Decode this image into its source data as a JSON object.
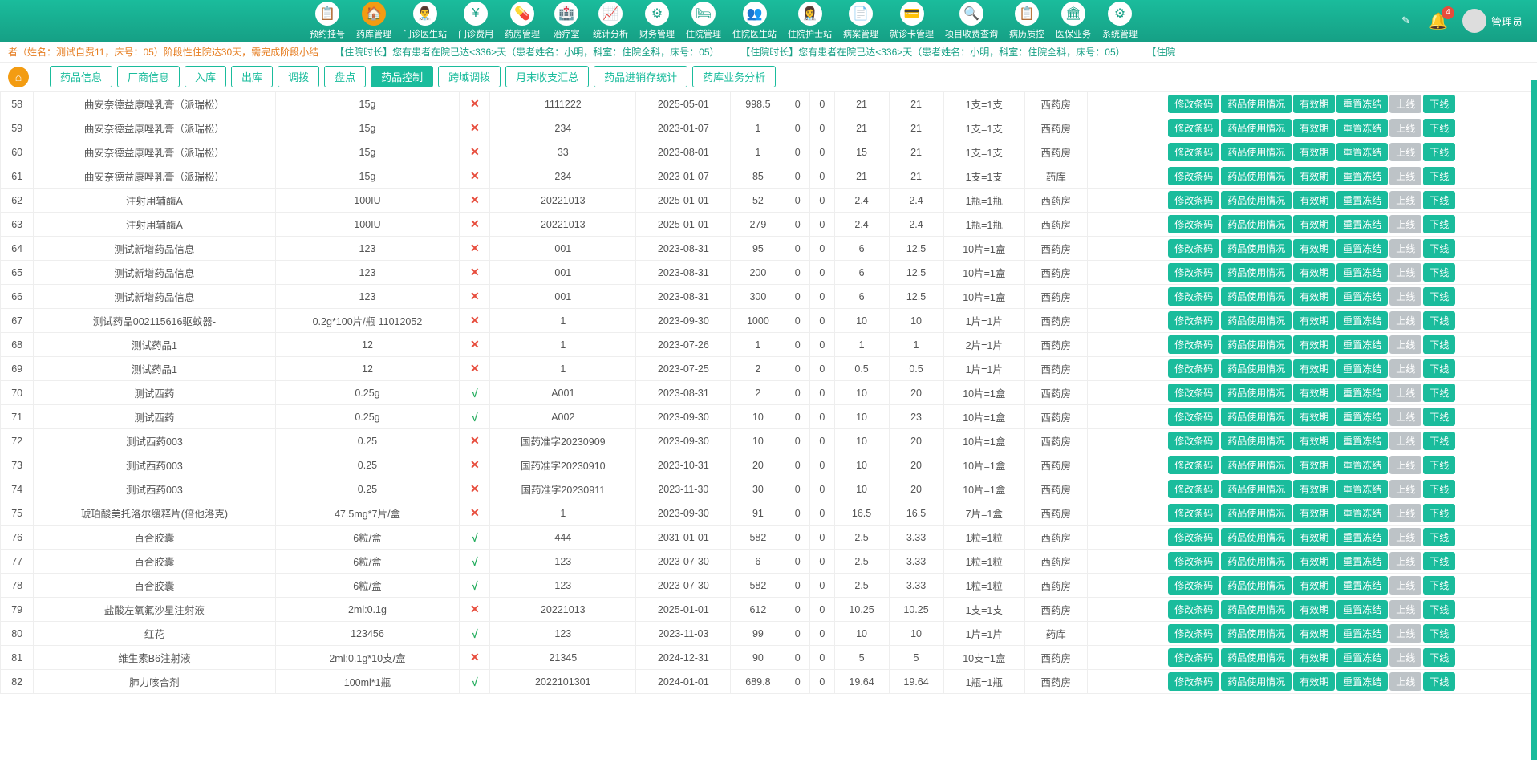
{
  "topnav": [
    {
      "label": "预约挂号",
      "icon": "📋"
    },
    {
      "label": "药库管理",
      "icon": "🏠",
      "active": true
    },
    {
      "label": "门诊医生站",
      "icon": "👨‍⚕️"
    },
    {
      "label": "门诊费用",
      "icon": "¥"
    },
    {
      "label": "药房管理",
      "icon": "💊"
    },
    {
      "label": "治疗室",
      "icon": "🏥"
    },
    {
      "label": "统计分析",
      "icon": "📈"
    },
    {
      "label": "财务管理",
      "icon": "⚙"
    },
    {
      "label": "住院管理",
      "icon": "🛏"
    },
    {
      "label": "住院医生站",
      "icon": "👥"
    },
    {
      "label": "住院护士站",
      "icon": "👩‍⚕️"
    },
    {
      "label": "病案管理",
      "icon": "📄"
    },
    {
      "label": "就诊卡管理",
      "icon": "💳"
    },
    {
      "label": "项目收费查询",
      "icon": "🔍"
    },
    {
      "label": "病历质控",
      "icon": "📋"
    },
    {
      "label": "医保业务",
      "icon": "🏛"
    },
    {
      "label": "系统管理",
      "icon": "⚙"
    }
  ],
  "notif_count": "4",
  "user_name": "管理员",
  "marquee": {
    "s1a": "者（姓名：测试自费11，床号：05）阶段性住院达30天，需完成阶段小结",
    "s1b": "【住院时长】您有患者在院已达<336>天（患者姓名：小明，科室：住院全科，床号：05）",
    "s1c": "【住院时长】您有患者在院已达<336>天（患者姓名：小明，科室：住院全科，床号：05）",
    "s1d": "【住院"
  },
  "tabs": [
    "药品信息",
    "厂商信息",
    "入库",
    "出库",
    "调拨",
    "盘点",
    "药品控制",
    "跨域调拨",
    "月末收支汇总",
    "药品进销存统计",
    "药库业务分析"
  ],
  "active_tab": 6,
  "actions": {
    "a1": "修改条码",
    "a2": "药品使用情况",
    "a3": "有效期",
    "a4": "重置冻结",
    "a5": "上线",
    "a6": "下线"
  },
  "rows": [
    {
      "idx": "58",
      "name": "曲安奈德益康唑乳膏（派瑞松）",
      "spec": "15g",
      "stop": "x",
      "batch": "1111222",
      "exp": "2025-05-01",
      "qty": "998.5",
      "c1": "0",
      "c2": "0",
      "c3": "21",
      "c4": "21",
      "unit": "1支=1支",
      "loc": "西药房"
    },
    {
      "idx": "59",
      "name": "曲安奈德益康唑乳膏（派瑞松）",
      "spec": "15g",
      "stop": "x",
      "batch": "234",
      "exp": "2023-01-07",
      "qty": "1",
      "c1": "0",
      "c2": "0",
      "c3": "21",
      "c4": "21",
      "unit": "1支=1支",
      "loc": "西药房"
    },
    {
      "idx": "60",
      "name": "曲安奈德益康唑乳膏（派瑞松）",
      "spec": "15g",
      "stop": "x",
      "batch": "33",
      "exp": "2023-08-01",
      "qty": "1",
      "c1": "0",
      "c2": "0",
      "c3": "15",
      "c4": "21",
      "unit": "1支=1支",
      "loc": "西药房"
    },
    {
      "idx": "61",
      "name": "曲安奈德益康唑乳膏（派瑞松）",
      "spec": "15g",
      "stop": "x",
      "batch": "234",
      "exp": "2023-01-07",
      "qty": "85",
      "c1": "0",
      "c2": "0",
      "c3": "21",
      "c4": "21",
      "unit": "1支=1支",
      "loc": "药库"
    },
    {
      "idx": "62",
      "name": "注射用辅酶A",
      "spec": "100IU",
      "stop": "x",
      "batch": "20221013",
      "exp": "2025-01-01",
      "qty": "52",
      "c1": "0",
      "c2": "0",
      "c3": "2.4",
      "c4": "2.4",
      "unit": "1瓶=1瓶",
      "loc": "西药房"
    },
    {
      "idx": "63",
      "name": "注射用辅酶A",
      "spec": "100IU",
      "stop": "x",
      "batch": "20221013",
      "exp": "2025-01-01",
      "qty": "279",
      "c1": "0",
      "c2": "0",
      "c3": "2.4",
      "c4": "2.4",
      "unit": "1瓶=1瓶",
      "loc": "西药房"
    },
    {
      "idx": "64",
      "name": "测试新增药品信息",
      "spec": "123",
      "stop": "x",
      "batch": "001",
      "exp": "2023-08-31",
      "qty": "95",
      "c1": "0",
      "c2": "0",
      "c3": "6",
      "c4": "12.5",
      "unit": "10片=1盒",
      "loc": "西药房"
    },
    {
      "idx": "65",
      "name": "测试新增药品信息",
      "spec": "123",
      "stop": "x",
      "batch": "001",
      "exp": "2023-08-31",
      "qty": "200",
      "c1": "0",
      "c2": "0",
      "c3": "6",
      "c4": "12.5",
      "unit": "10片=1盒",
      "loc": "西药房"
    },
    {
      "idx": "66",
      "name": "测试新增药品信息",
      "spec": "123",
      "stop": "x",
      "batch": "001",
      "exp": "2023-08-31",
      "qty": "300",
      "c1": "0",
      "c2": "0",
      "c3": "6",
      "c4": "12.5",
      "unit": "10片=1盒",
      "loc": "西药房"
    },
    {
      "idx": "67",
      "name": "测试药品002115616驱蚊器-",
      "spec": "0.2g*100片/瓶 11012052",
      "stop": "x",
      "batch": "1",
      "exp": "2023-09-30",
      "qty": "1000",
      "c1": "0",
      "c2": "0",
      "c3": "10",
      "c4": "10",
      "unit": "1片=1片",
      "loc": "西药房"
    },
    {
      "idx": "68",
      "name": "测试药品1",
      "spec": "12",
      "stop": "x",
      "batch": "1",
      "exp": "2023-07-26",
      "qty": "1",
      "c1": "0",
      "c2": "0",
      "c3": "1",
      "c4": "1",
      "unit": "2片=1片",
      "loc": "西药房"
    },
    {
      "idx": "69",
      "name": "测试药品1",
      "spec": "12",
      "stop": "x",
      "batch": "1",
      "exp": "2023-07-25",
      "qty": "2",
      "c1": "0",
      "c2": "0",
      "c3": "0.5",
      "c4": "0.5",
      "unit": "1片=1片",
      "loc": "西药房"
    },
    {
      "idx": "70",
      "name": "测试西药",
      "spec": "0.25g",
      "stop": "v",
      "batch": "A001",
      "exp": "2023-08-31",
      "qty": "2",
      "c1": "0",
      "c2": "0",
      "c3": "10",
      "c4": "20",
      "unit": "10片=1盒",
      "loc": "西药房"
    },
    {
      "idx": "71",
      "name": "测试西药",
      "spec": "0.25g",
      "stop": "v",
      "batch": "A002",
      "exp": "2023-09-30",
      "qty": "10",
      "c1": "0",
      "c2": "0",
      "c3": "10",
      "c4": "23",
      "unit": "10片=1盒",
      "loc": "西药房"
    },
    {
      "idx": "72",
      "name": "测试西药003",
      "spec": "0.25",
      "stop": "x",
      "batch": "国药准字20230909",
      "exp": "2023-09-30",
      "qty": "10",
      "c1": "0",
      "c2": "0",
      "c3": "10",
      "c4": "20",
      "unit": "10片=1盒",
      "loc": "西药房"
    },
    {
      "idx": "73",
      "name": "测试西药003",
      "spec": "0.25",
      "stop": "x",
      "batch": "国药准字20230910",
      "exp": "2023-10-31",
      "qty": "20",
      "c1": "0",
      "c2": "0",
      "c3": "10",
      "c4": "20",
      "unit": "10片=1盒",
      "loc": "西药房"
    },
    {
      "idx": "74",
      "name": "测试西药003",
      "spec": "0.25",
      "stop": "x",
      "batch": "国药准字20230911",
      "exp": "2023-11-30",
      "qty": "30",
      "c1": "0",
      "c2": "0",
      "c3": "10",
      "c4": "20",
      "unit": "10片=1盒",
      "loc": "西药房"
    },
    {
      "idx": "75",
      "name": "琥珀酸美托洛尔缓释片(倍他洛克)",
      "spec": "47.5mg*7片/盒",
      "stop": "x",
      "batch": "1",
      "exp": "2023-09-30",
      "qty": "91",
      "c1": "0",
      "c2": "0",
      "c3": "16.5",
      "c4": "16.5",
      "unit": "7片=1盒",
      "loc": "西药房"
    },
    {
      "idx": "76",
      "name": "百合胶囊",
      "spec": "6粒/盒",
      "stop": "v",
      "batch": "444",
      "exp": "2031-01-01",
      "qty": "582",
      "c1": "0",
      "c2": "0",
      "c3": "2.5",
      "c4": "3.33",
      "unit": "1粒=1粒",
      "loc": "西药房"
    },
    {
      "idx": "77",
      "name": "百合胶囊",
      "spec": "6粒/盒",
      "stop": "v",
      "batch": "123",
      "exp": "2023-07-30",
      "qty": "6",
      "c1": "0",
      "c2": "0",
      "c3": "2.5",
      "c4": "3.33",
      "unit": "1粒=1粒",
      "loc": "西药房"
    },
    {
      "idx": "78",
      "name": "百合胶囊",
      "spec": "6粒/盒",
      "stop": "v",
      "batch": "123",
      "exp": "2023-07-30",
      "qty": "582",
      "c1": "0",
      "c2": "0",
      "c3": "2.5",
      "c4": "3.33",
      "unit": "1粒=1粒",
      "loc": "西药房"
    },
    {
      "idx": "79",
      "name": "盐酸左氧氟沙星注射液",
      "spec": "2ml:0.1g",
      "stop": "x",
      "batch": "20221013",
      "exp": "2025-01-01",
      "qty": "612",
      "c1": "0",
      "c2": "0",
      "c3": "10.25",
      "c4": "10.25",
      "unit": "1支=1支",
      "loc": "西药房"
    },
    {
      "idx": "80",
      "name": "红花",
      "spec": "123456",
      "stop": "v",
      "batch": "123",
      "exp": "2023-11-03",
      "qty": "99",
      "c1": "0",
      "c2": "0",
      "c3": "10",
      "c4": "10",
      "unit": "1片=1片",
      "loc": "药库"
    },
    {
      "idx": "81",
      "name": "维生素B6注射液",
      "spec": "2ml:0.1g*10支/盒",
      "stop": "x",
      "batch": "21345",
      "exp": "2024-12-31",
      "qty": "90",
      "c1": "0",
      "c2": "0",
      "c3": "5",
      "c4": "5",
      "unit": "10支=1盒",
      "loc": "西药房"
    },
    {
      "idx": "82",
      "name": "肺力咳合剂",
      "spec": "100ml*1瓶",
      "stop": "v",
      "batch": "2022101301",
      "exp": "2024-01-01",
      "qty": "689.8",
      "c1": "0",
      "c2": "0",
      "c3": "19.64",
      "c4": "19.64",
      "unit": "1瓶=1瓶",
      "loc": "西药房"
    }
  ]
}
